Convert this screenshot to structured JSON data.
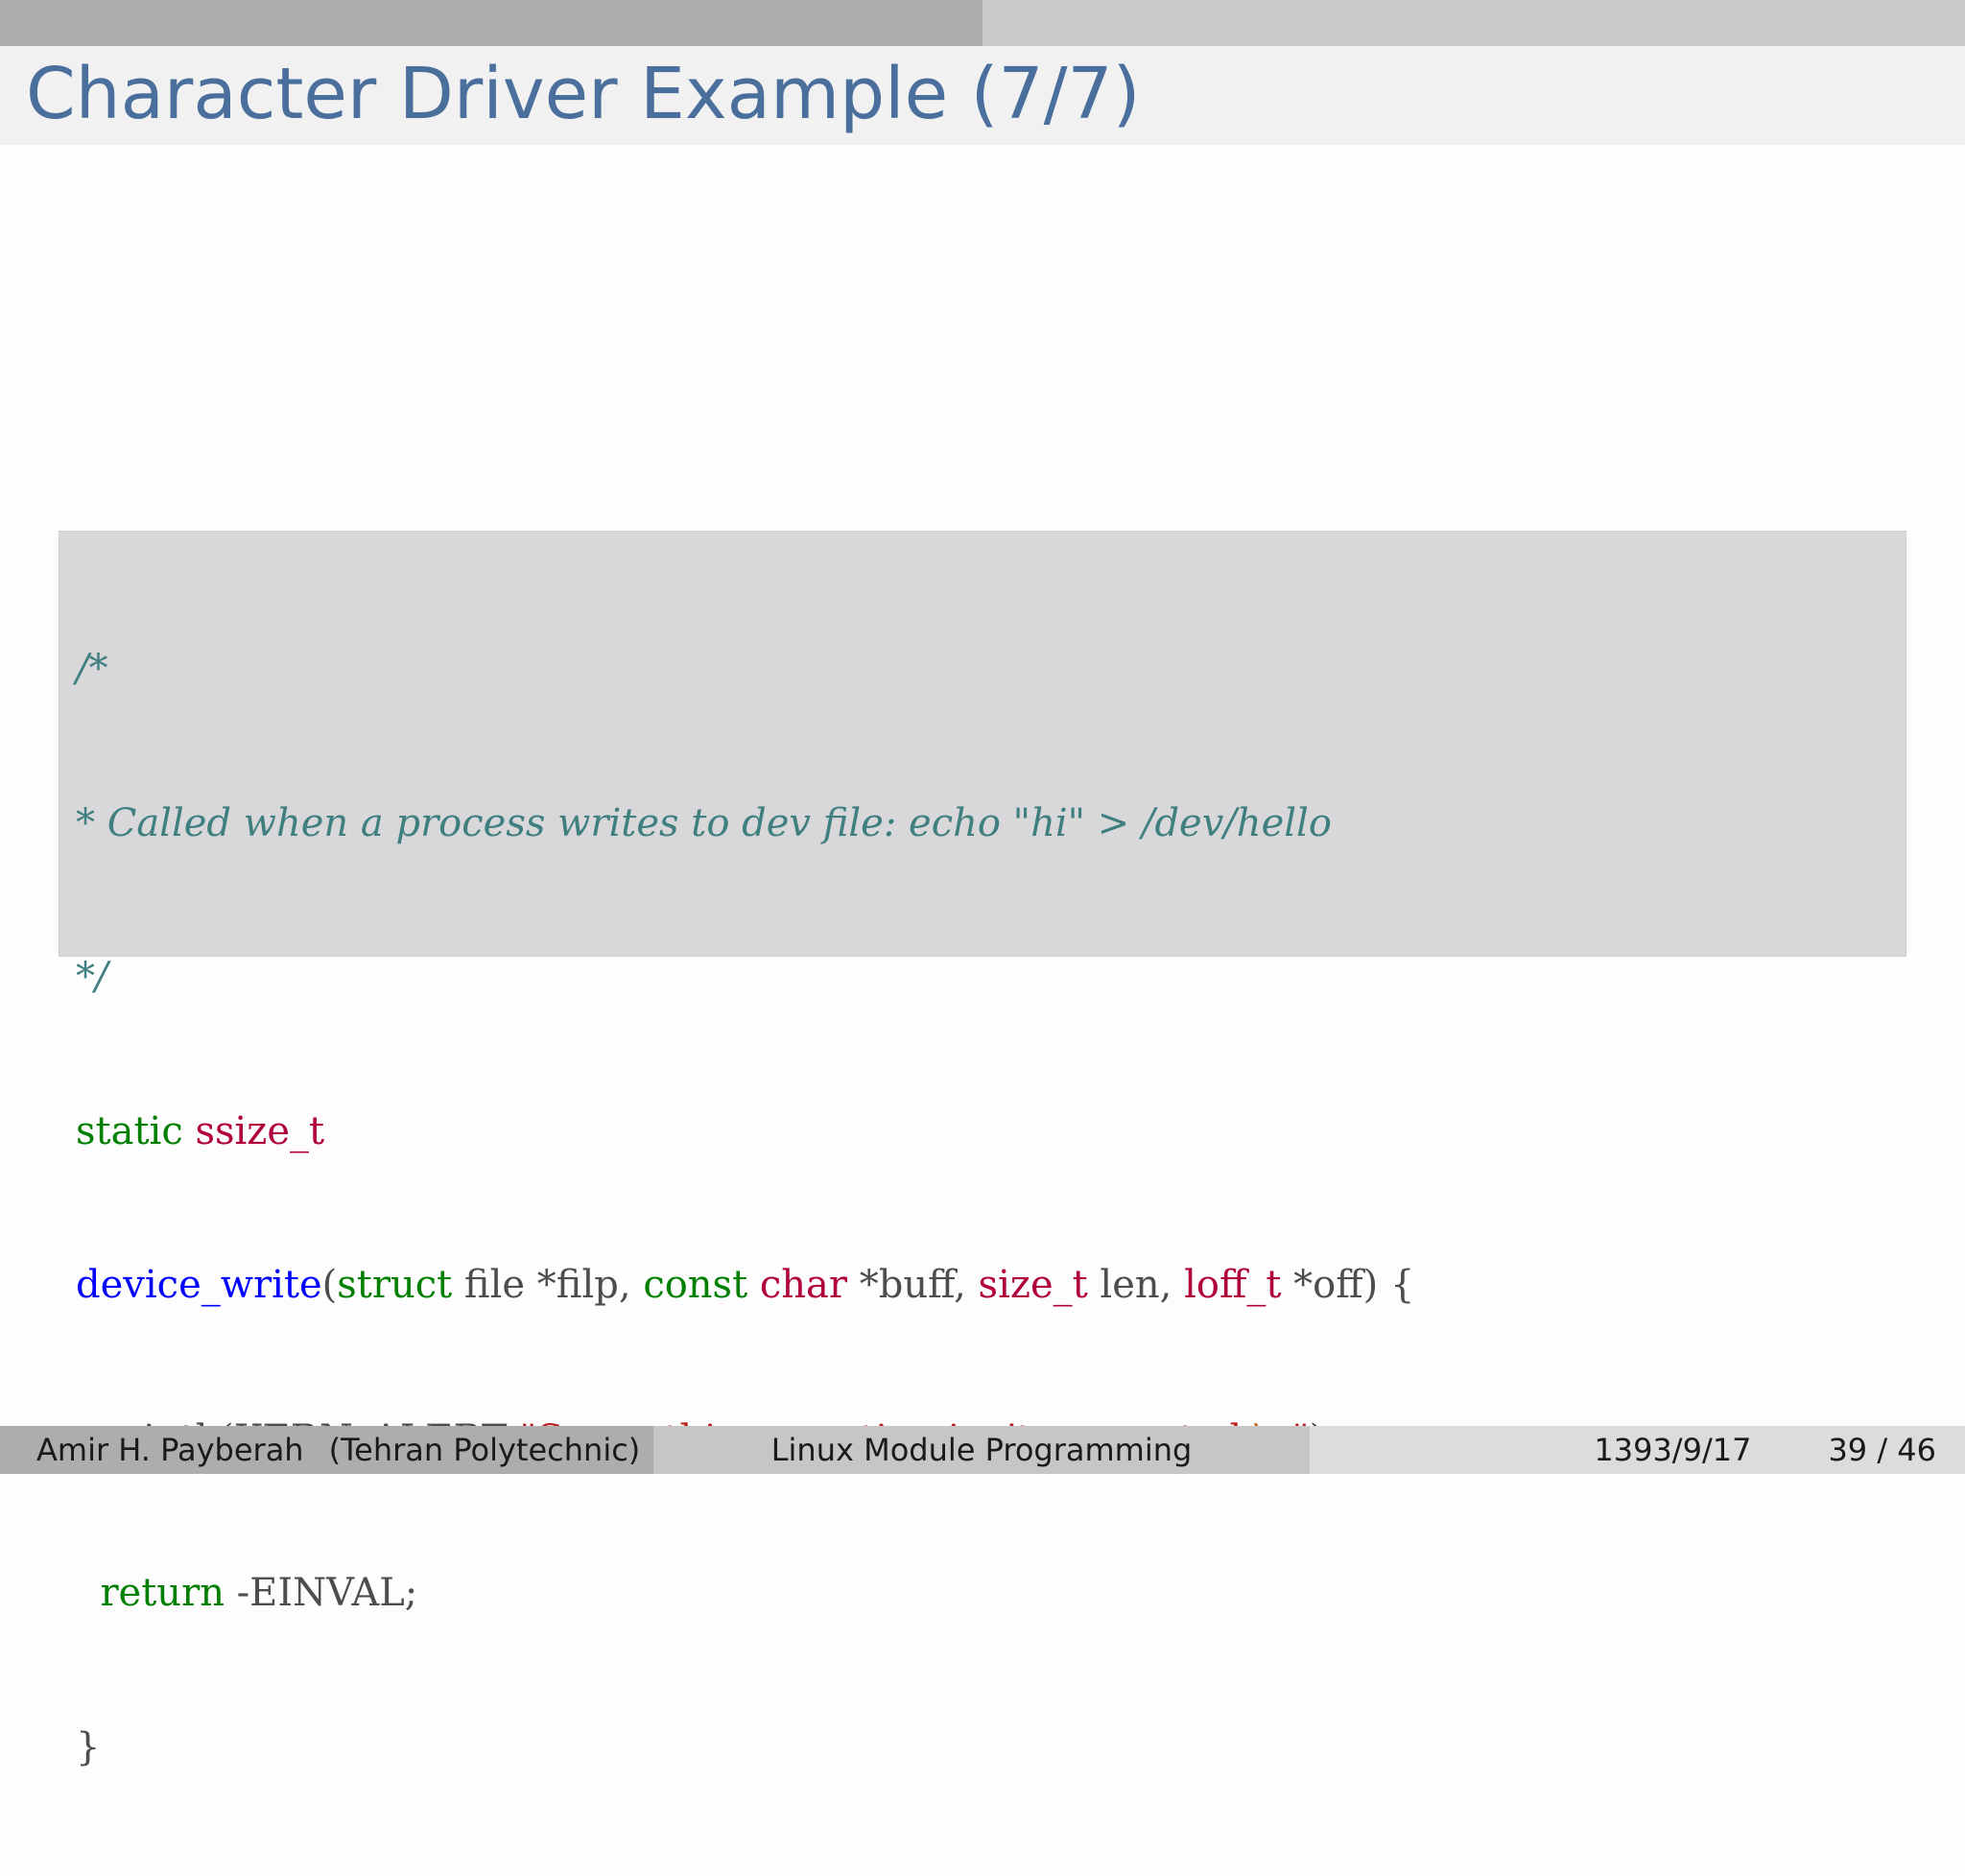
{
  "slide": {
    "title": "Character Driver Example (7/7)"
  },
  "code": {
    "line1": {
      "comment": "/*"
    },
    "line2": {
      "comment": "* Called when a process writes to dev file: echo \"hi\" > /dev/hello"
    },
    "line3": {
      "comment": "*/"
    },
    "line4": {
      "kw_static": "static",
      "sp": " ",
      "type_ssize": "ssize_t"
    },
    "line5": {
      "func": "device_write",
      "p1": "(",
      "kw_struct": "struct",
      "p2": " file *filp, ",
      "kw_const": "const",
      "p3": " ",
      "type_char": "char",
      "p4": " *buff, ",
      "type_size": "size_t",
      "p5": " len, ",
      "type_loff": "loff_t",
      "p6": " *off) {"
    },
    "line6": {
      "indent": "  ",
      "p1": "printk(KERN_ALERT ",
      "str1": "\"Sorry, this operation isn’t supported.",
      "esc": "\\n",
      "str2": "\"",
      "p2": ");"
    },
    "line7": {
      "indent": "  ",
      "kw_return": "return",
      "p1": " -EINVAL;"
    },
    "line8": {
      "p1": "}"
    }
  },
  "footer": {
    "author": "Amir H. Payberah",
    "affiliation": "(Tehran Polytechnic)",
    "presentation_title": "Linux Module Programming",
    "date": "1393/9/17",
    "page_number": "39 / 46"
  }
}
